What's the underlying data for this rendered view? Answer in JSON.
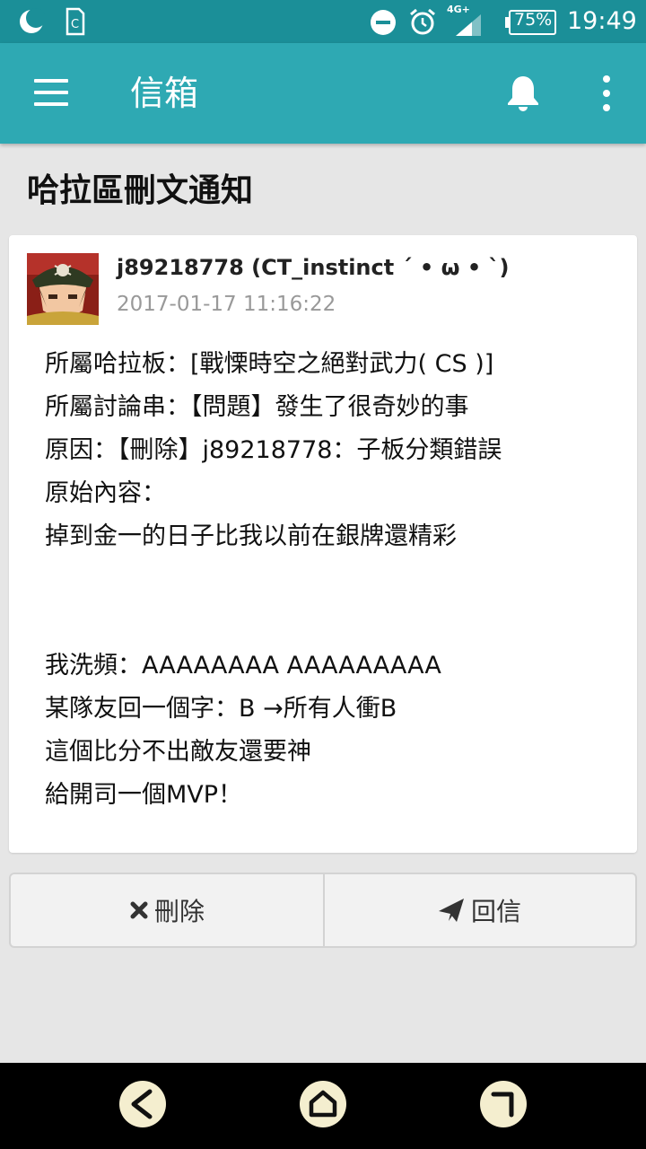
{
  "status_bar": {
    "network": "4G+",
    "battery": "75%",
    "time": "19:49"
  },
  "app_bar": {
    "title": "信箱"
  },
  "page": {
    "title": "哈拉區刪文通知"
  },
  "message": {
    "author": "j89218778 (CT_instinct ˊ • ω • ˋ)",
    "timestamp": "2017-01-17 11:16:22",
    "lines": [
      "所屬哈拉板：[戰慄時空之絕對武力( CS )]",
      "所屬討論串：【問題】發生了很奇妙的事",
      "原因：【刪除】j89218778：子板分類錯誤",
      "原始內容：",
      "掉到金一的日子比我以前在銀牌還精彩",
      "",
      "",
      "我洗頻：AAAAAAAA AAAAAAAAA",
      "某隊友回一個字：B →所有人衝B",
      "這個比分不出敵友還要神",
      "給開司一個MVP！"
    ]
  },
  "actions": {
    "delete_label": "刪除",
    "reply_label": "回信"
  },
  "colors": {
    "app_bar": "#2ea9b3",
    "status_bar": "#1b8f98",
    "nav_button": "#f4eecf"
  }
}
